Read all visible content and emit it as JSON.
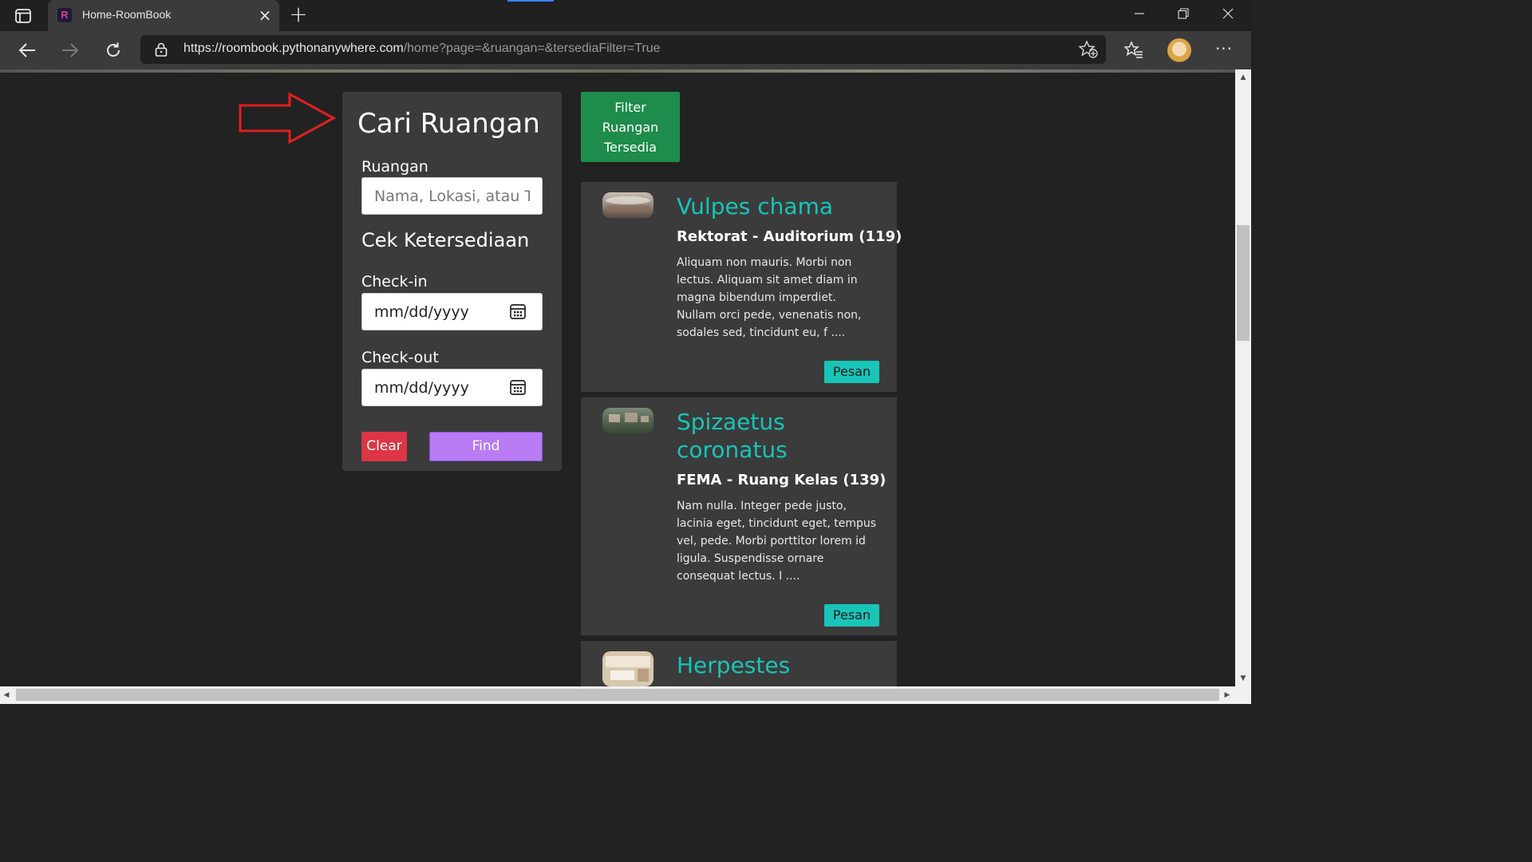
{
  "browser": {
    "tab_title": "Home-RoomBook",
    "tab_favicon_letter": "R",
    "url_host": "https://roombook.pythonanywhere.com",
    "url_path": "/home?page=&ruangan=&tersediaFilter=True",
    "window_buttons": [
      "minimize-icon",
      "restore-icon",
      "close-icon"
    ]
  },
  "search": {
    "title": "Cari Ruangan",
    "room_label": "Ruangan",
    "room_placeholder": "Nama, Lokasi, atau Tipe",
    "availability_title": "Cek Ketersediaan",
    "checkin_label": "Check-in",
    "checkin_value": "mm/dd/yyyy",
    "checkout_label": "Check-out",
    "checkout_value": "mm/dd/yyyy",
    "clear_label": "Clear",
    "find_label": "Find"
  },
  "filter_button": {
    "lines": [
      "Filter",
      "Ruangan",
      "Tersedia"
    ]
  },
  "rooms": [
    {
      "name": "Vulpes chama",
      "location": "Rektorat",
      "type_capacity": "Auditorium (119)",
      "description": "Aliquam non mauris. Morbi non lectus. Aliquam sit amet diam in magna bibendum imperdiet. Nullam orci pede, venenatis non, sodales sed, tincidunt eu, f ....",
      "book_label": "Pesan"
    },
    {
      "name": "Spizaetus coronatus",
      "location": "FEMA",
      "type_capacity": "Ruang Kelas (139)",
      "description": "Nam nulla. Integer pede justo, lacinia eget, tincidunt eget, tempus vel, pede. Morbi porttitor lorem id ligula. Suspendisse ornare consequat lectus. I ....",
      "book_label": "Pesan"
    },
    {
      "name": "Herpestes",
      "location": "",
      "type_capacity": "",
      "description": "",
      "book_label": ""
    }
  ],
  "colors": {
    "accent_teal": "#18c5b8",
    "filter_green": "#1e8c4a",
    "clear_red": "#dc3545",
    "find_purple": "#b97cf5",
    "annotation_arrow": "#e02020"
  }
}
